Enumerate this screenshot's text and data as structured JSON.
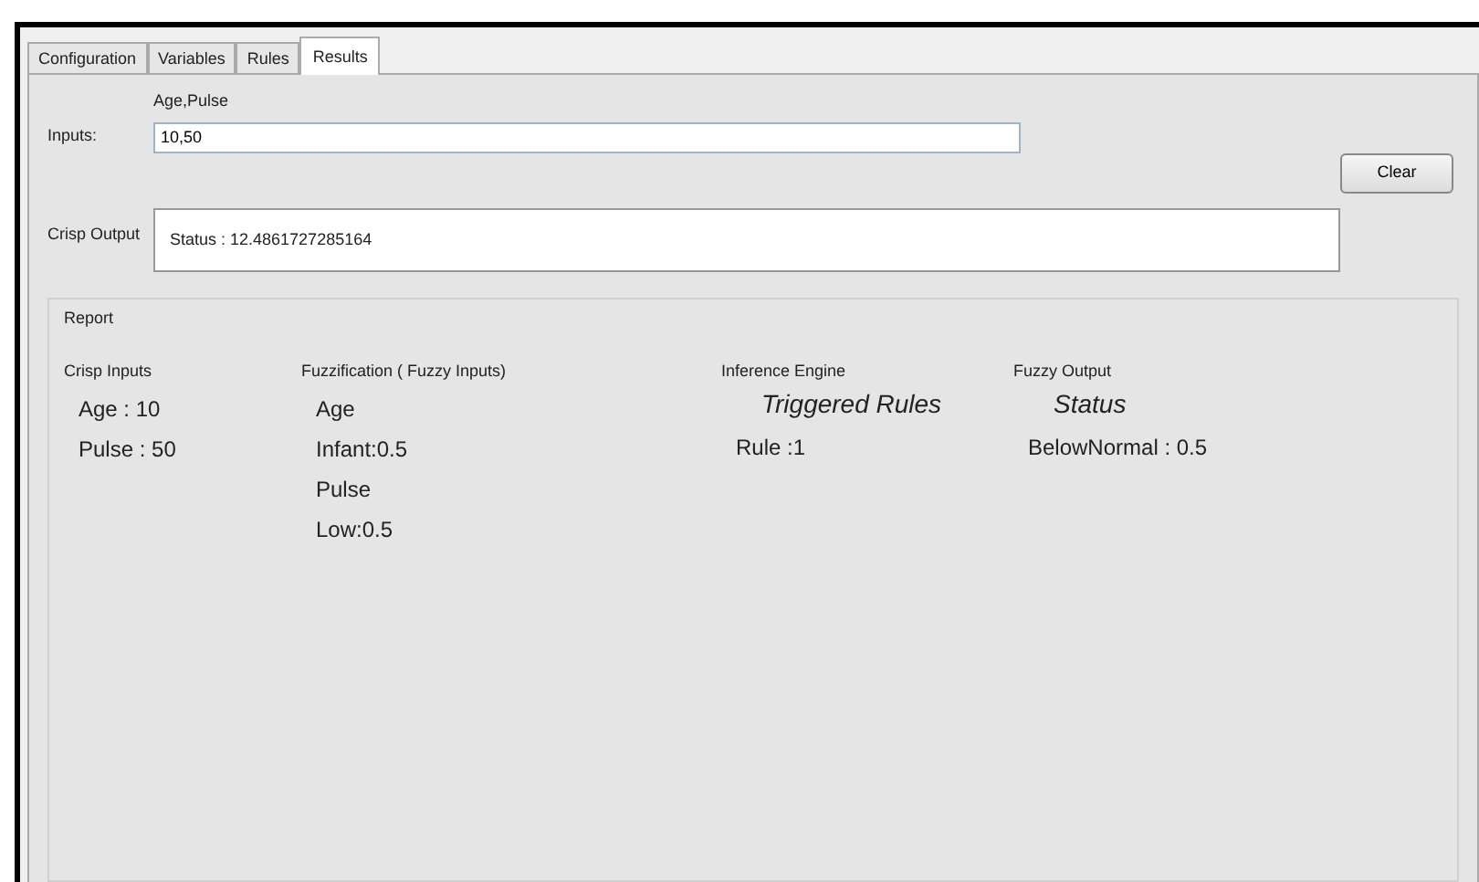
{
  "tabs": [
    {
      "label": "Configuration",
      "selected": false
    },
    {
      "label": "Variables",
      "selected": false
    },
    {
      "label": "Rules",
      "selected": false
    },
    {
      "label": "Results",
      "selected": true
    }
  ],
  "inputs": {
    "hint": "Age,Pulse",
    "label": "Inputs:",
    "value": "10,50"
  },
  "clear_button": "Clear",
  "crisp_output": {
    "label": "Crisp Output",
    "value": "Status : 12.4861727285164"
  },
  "report": {
    "title": "Report",
    "columns": [
      {
        "heading": "Crisp Inputs",
        "lines": [
          {
            "text": "Age : 10",
            "kind": "value"
          },
          {
            "text": "Pulse : 50",
            "kind": "value"
          }
        ]
      },
      {
        "heading": "Fuzzification ( Fuzzy Inputs)",
        "lines": [
          {
            "text": "Age",
            "kind": "value"
          },
          {
            "text": "Infant:0.5",
            "kind": "value"
          },
          {
            "text": "Pulse",
            "kind": "value"
          },
          {
            "text": "Low:0.5",
            "kind": "value"
          }
        ]
      },
      {
        "heading": "Inference Engine",
        "lines": [
          {
            "text": "Triggered Rules",
            "kind": "title"
          },
          {
            "text": "Rule :1",
            "kind": "value"
          }
        ]
      },
      {
        "heading": "Fuzzy Output",
        "lines": [
          {
            "text": "Status",
            "kind": "title"
          },
          {
            "text": "BelowNormal : 0.5",
            "kind": "value"
          }
        ]
      }
    ]
  }
}
